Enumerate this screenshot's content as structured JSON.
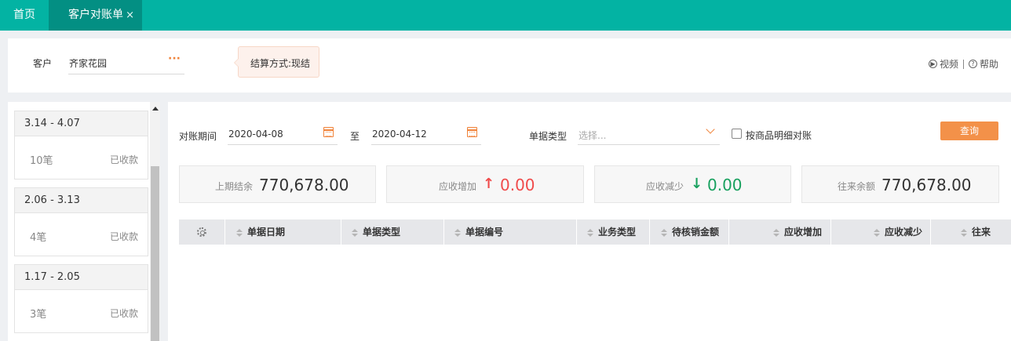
{
  "tabs": {
    "home": "首页",
    "active": "客户对账单",
    "close_glyph": "×"
  },
  "customer": {
    "label": "客户",
    "value": "齐家花园",
    "more_glyph": "···"
  },
  "settlement": {
    "text": "结算方式:现结"
  },
  "top_links": {
    "video": "视频",
    "help": "帮助"
  },
  "period_cards": [
    {
      "range": "3.14 - 4.07",
      "count": "10笔",
      "status": "已收款"
    },
    {
      "range": "2.06 - 3.13",
      "count": "4笔",
      "status": "已收款"
    },
    {
      "range": "1.17 - 2.05",
      "count": "3笔",
      "status": "已收款"
    }
  ],
  "filters": {
    "period_label": "对账期间",
    "start_date": "2020-04-08",
    "to_label": "至",
    "end_date": "2020-04-12",
    "doc_type_label": "单据类型",
    "doc_type_placeholder": "选择...",
    "detail_checkbox_label": "按商品明细对账",
    "detail_checked": false,
    "query_button": "查询"
  },
  "stats": {
    "opening": {
      "label": "上期结余",
      "value": "770,678.00"
    },
    "increase": {
      "label": "应收增加",
      "value": "0.00",
      "arrow": "↑"
    },
    "decrease": {
      "label": "应收减少",
      "value": "0.00",
      "arrow": "↓"
    },
    "balance": {
      "label": "往来余额",
      "value": "770,678.00"
    }
  },
  "table": {
    "columns": [
      "单据日期",
      "单据类型",
      "单据编号",
      "业务类型",
      "待核销金额",
      "应收增加",
      "应收减少",
      "往来"
    ]
  },
  "colors": {
    "brand": "#03b3a3",
    "brand_dark": "#038f83",
    "accent": "#f39149",
    "up": "#f04b4b",
    "down": "#19a15f"
  }
}
